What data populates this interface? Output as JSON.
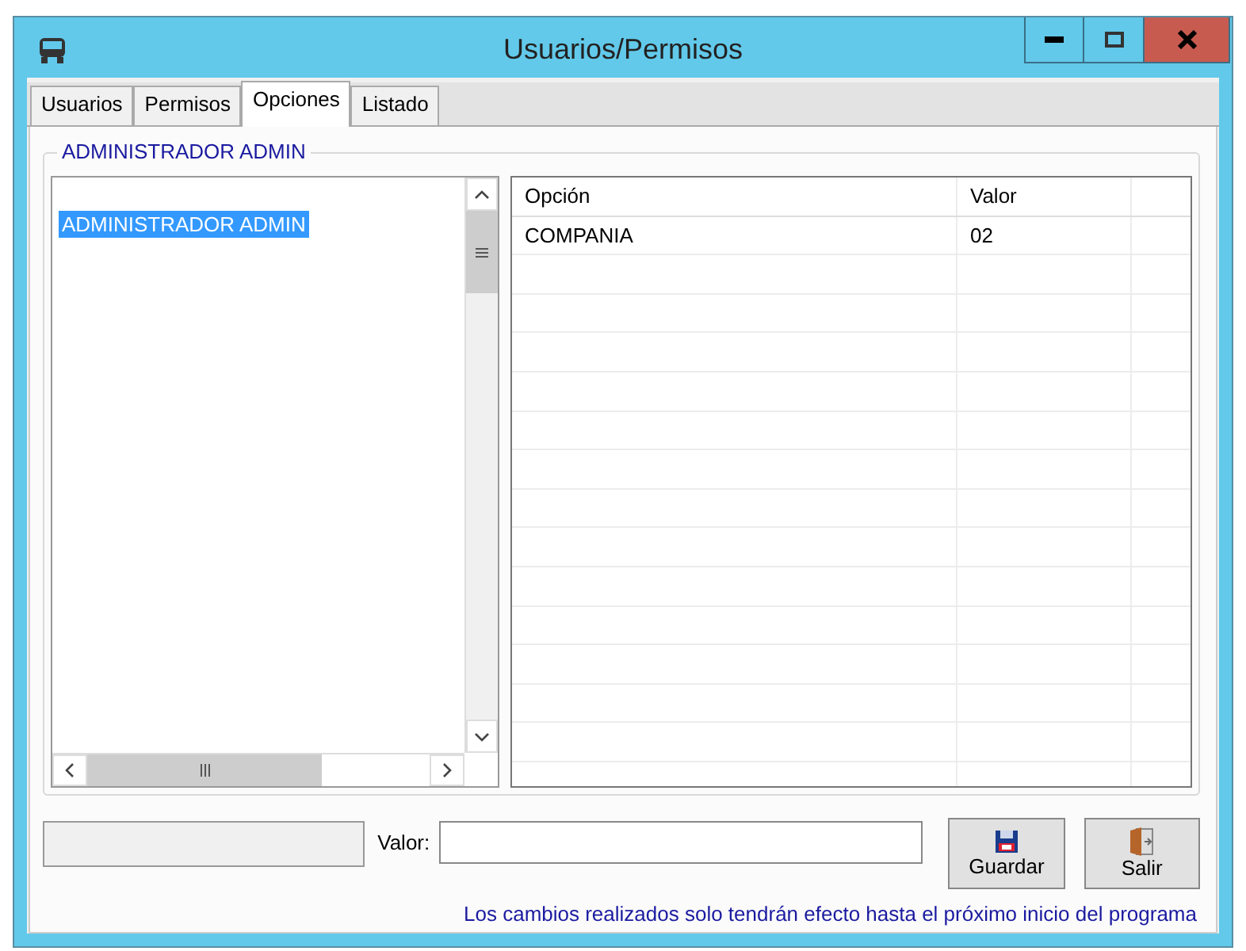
{
  "window": {
    "title": "Usuarios/Permisos"
  },
  "tabs": [
    {
      "label": "Usuarios",
      "selected": false
    },
    {
      "label": "Permisos",
      "selected": false
    },
    {
      "label": "Opciones",
      "selected": true
    },
    {
      "label": "Listado",
      "selected": false
    }
  ],
  "group": {
    "title": "ADMINISTRADOR  ADMIN"
  },
  "user_list": {
    "items": [
      {
        "label": "ADMINISTRADOR  ADMIN",
        "selected": true
      }
    ]
  },
  "grid": {
    "columns": [
      "Opción",
      "Valor"
    ],
    "rows": [
      {
        "cells": [
          "COMPANIA",
          "02"
        ]
      }
    ]
  },
  "value_field": {
    "label": "Valor:"
  },
  "buttons": [
    {
      "label": "Guardar",
      "kind": "save"
    },
    {
      "label": "Salir",
      "kind": "exit"
    }
  ],
  "note": "Los cambios realizados solo tendrán efecto hasta el próximo inicio del programa"
}
